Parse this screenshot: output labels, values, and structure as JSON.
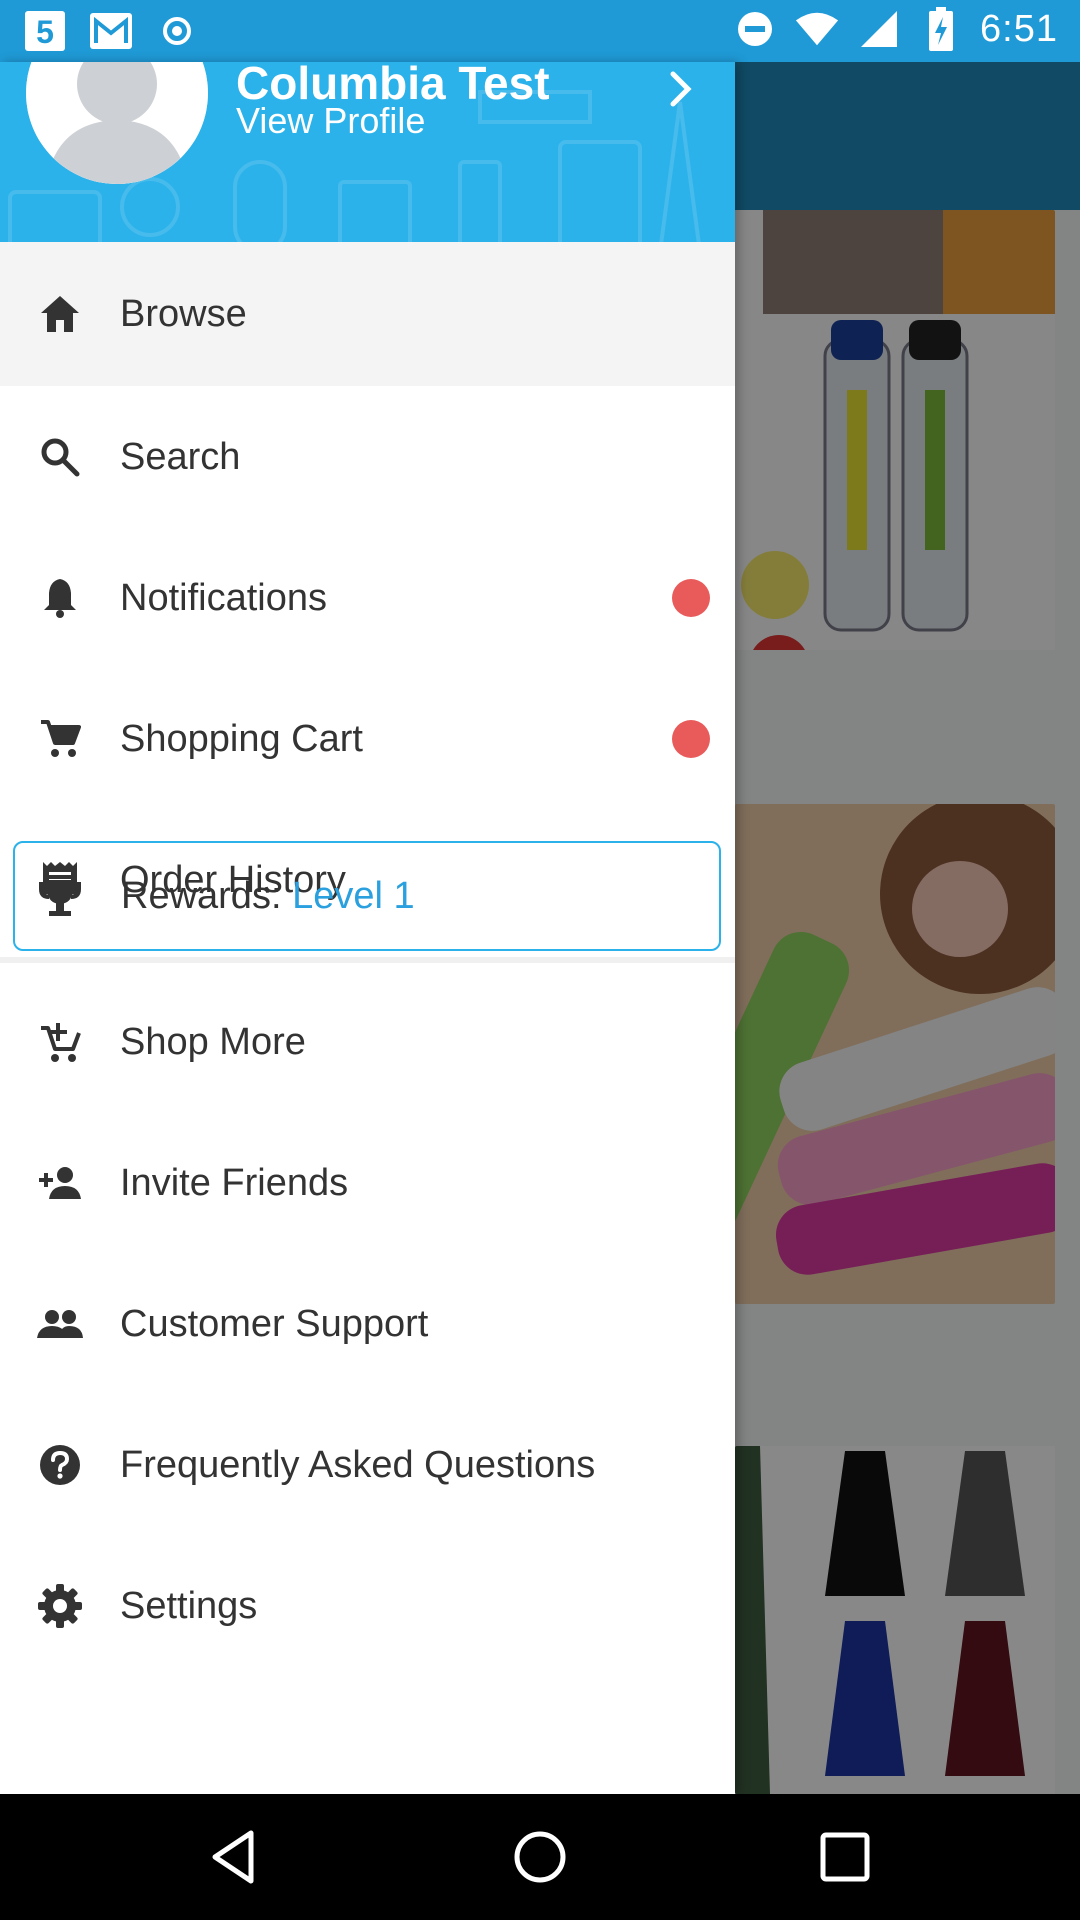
{
  "status_bar": {
    "time": "6:51",
    "left_icons": [
      "app-5-icon",
      "gmail-icon",
      "radio-dot-icon"
    ],
    "right_icons": [
      "dnd-icon",
      "wifi-icon",
      "signal-icon",
      "battery-charging-icon"
    ]
  },
  "profile": {
    "name": "Columbia Test",
    "link": "View Profile"
  },
  "menu": {
    "browse": "Browse",
    "search": "Search",
    "notifications": "Notifications",
    "cart": "Shopping Cart",
    "orders": "Order History",
    "rewards_label": "Rewards:",
    "rewards_level": "Level 1",
    "shop_more": "Shop More",
    "invite": "Invite Friends",
    "support": "Customer Support",
    "faq": "Frequently Asked Questions",
    "settings": "Settings"
  },
  "colors": {
    "accent": "#2cb2ea",
    "status_bar": "#1f9ad6",
    "badge": "#e95a5b"
  }
}
